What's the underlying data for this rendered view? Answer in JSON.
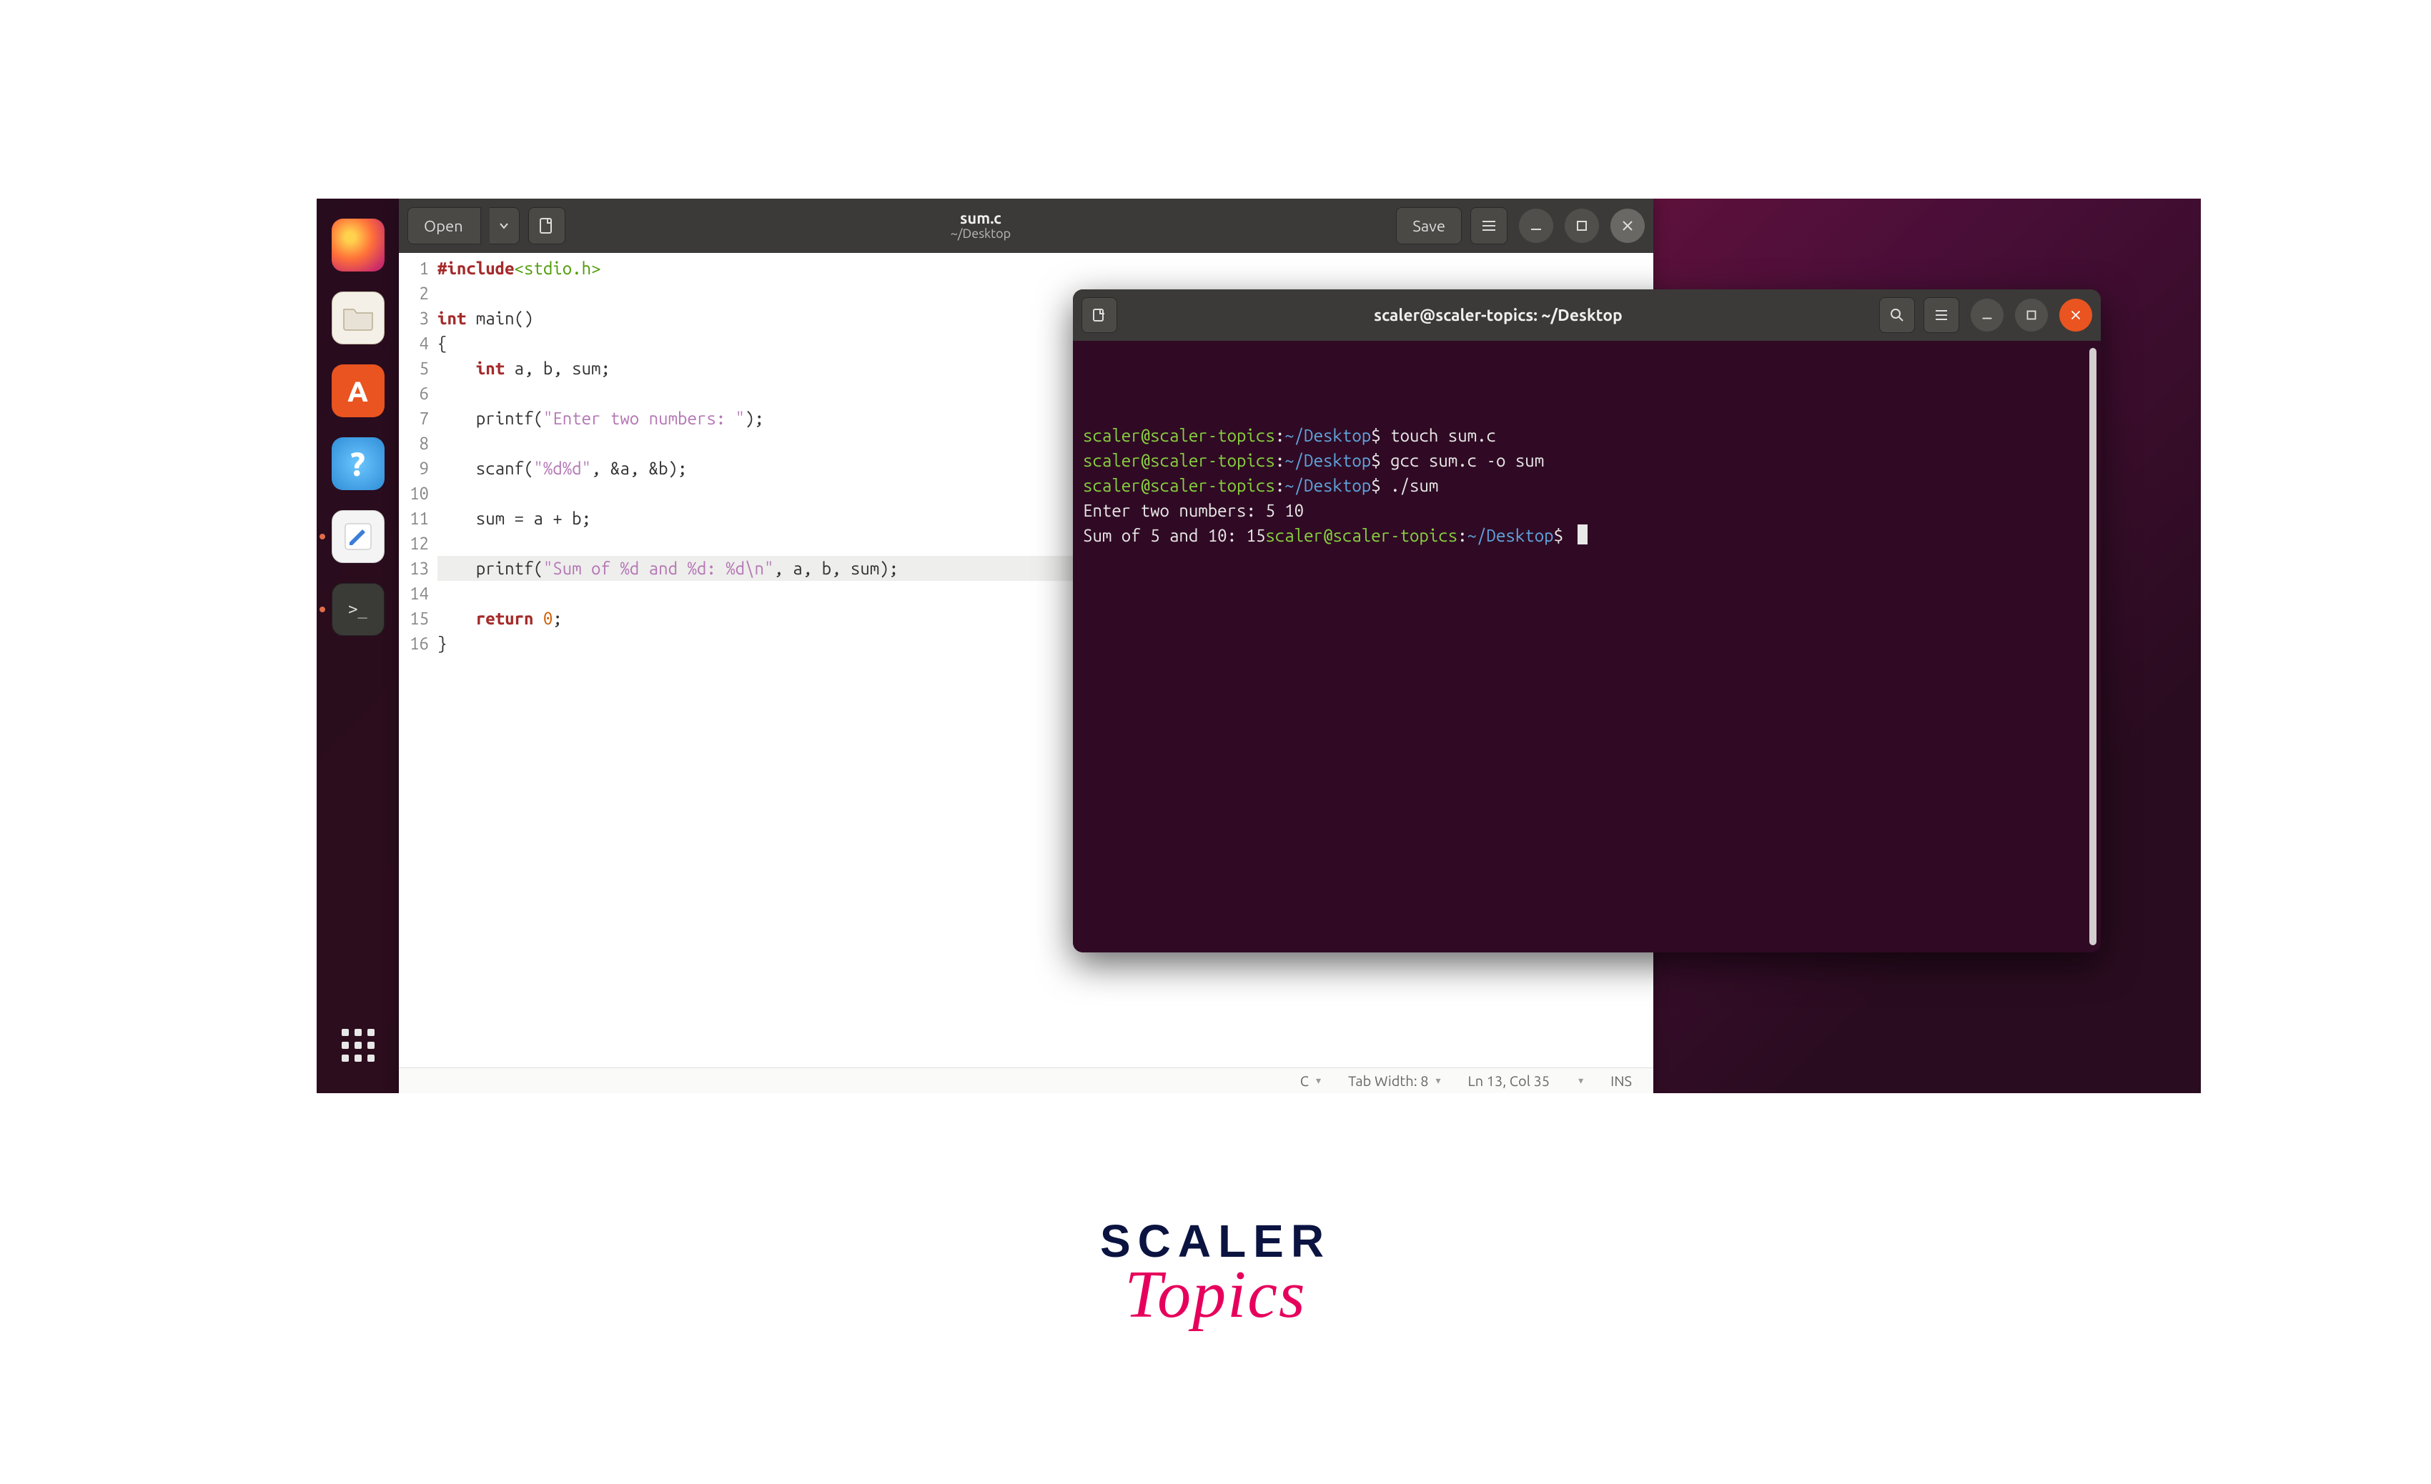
{
  "dock": {
    "items": [
      {
        "name": "firefox-icon",
        "color": "#ff7139"
      },
      {
        "name": "files-icon",
        "color": "#e8e2d6"
      },
      {
        "name": "software-icon",
        "color": "#e95420"
      },
      {
        "name": "help-icon",
        "color": "#3fa9f5"
      },
      {
        "name": "gedit-icon",
        "color": "#f4f4f4",
        "running": true
      },
      {
        "name": "terminal-icon",
        "color": "#3a3a36",
        "running": true
      }
    ]
  },
  "gedit": {
    "open_label": "Open",
    "save_label": "Save",
    "title": "sum.c",
    "subtitle": "~/Desktop",
    "code_lines": [
      {
        "n": 1,
        "html": "<span class='pre'>#include</span><span class='inc'>&lt;stdio.h&gt;</span>"
      },
      {
        "n": 2,
        "html": ""
      },
      {
        "n": 3,
        "html": "<span class='kw'>int</span> main()"
      },
      {
        "n": 4,
        "html": "{"
      },
      {
        "n": 5,
        "html": "    <span class='kw'>int</span> a, b, sum;"
      },
      {
        "n": 6,
        "html": ""
      },
      {
        "n": 7,
        "html": "    printf(<span class='str'>\"Enter two numbers: \"</span>);"
      },
      {
        "n": 8,
        "html": ""
      },
      {
        "n": 9,
        "html": "    scanf(<span class='str'>\"%d%d\"</span>, &amp;a, &amp;b);"
      },
      {
        "n": 10,
        "html": ""
      },
      {
        "n": 11,
        "html": "    sum = a + b;"
      },
      {
        "n": 12,
        "html": ""
      },
      {
        "n": 13,
        "html": "    printf(<span class='str'>\"Sum of %d and %d: %d\\n\"</span>, a, b, sum);",
        "highlight": true
      },
      {
        "n": 14,
        "html": ""
      },
      {
        "n": 15,
        "html": "    <span class='kw'>return</span> <span class='num'>0</span>;"
      },
      {
        "n": 16,
        "html": "}"
      }
    ],
    "status": {
      "lang": "C",
      "tabwidth": "Tab Width: 8",
      "pos": "Ln 13, Col 35",
      "insert": "INS"
    }
  },
  "terminal": {
    "title": "scaler@scaler-topics: ~/Desktop",
    "prompt_user": "scaler@scaler-topics",
    "prompt_path": "~/Desktop",
    "lines": [
      {
        "type": "cmd",
        "cmd": "touch sum.c"
      },
      {
        "type": "cmd",
        "cmd": "gcc sum.c -o sum"
      },
      {
        "type": "cmd",
        "cmd": "./sum"
      },
      {
        "type": "out",
        "text": "Enter two numbers: 5 10"
      },
      {
        "type": "mixed",
        "out": "Sum of 5 and 10: 15",
        "prompt_after": true
      }
    ]
  },
  "logo": {
    "line1": "SCALER",
    "line2": "Topics"
  }
}
